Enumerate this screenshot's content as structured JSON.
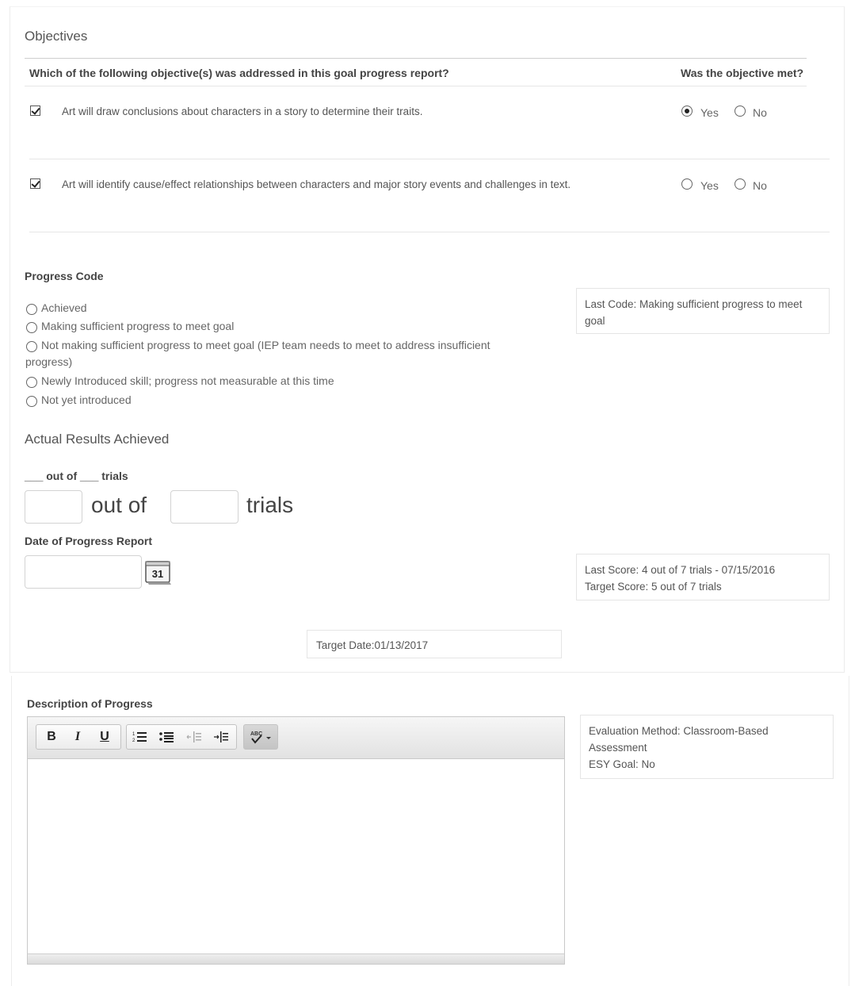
{
  "objectives": {
    "title": "Objectives",
    "question": "Which of the following objective(s) was addressed in this goal progress report?",
    "met_header": "Was the objective met?",
    "items": [
      {
        "text": "Art will draw conclusions about characters in a story to determine their traits.",
        "checked": true,
        "met": "Yes"
      },
      {
        "text": "Art will identify cause/effect relationships between characters and major story events and challenges in text.",
        "checked": true,
        "met": null
      }
    ],
    "yes_label": "Yes",
    "no_label": "No"
  },
  "progress_code": {
    "label": "Progress Code",
    "options": [
      "Achieved",
      "Making sufficient progress to meet goal",
      "Not making sufficient progress to meet goal (IEP team needs to meet to address insufficient",
      "progress)",
      "Newly Introduced skill; progress not measurable at this time",
      "Not yet introduced"
    ],
    "last_code": "Last Code: Making sufficient progress to meet goal"
  },
  "results": {
    "title": "Actual Results Achieved",
    "format_label": "___ out of ___ trials",
    "out_of": "out of",
    "trials": "trials",
    "date_label": "Date of Progress Report",
    "calendar_day": "31",
    "last_score": "Last Score: 4 out of 7 trials - 07/15/2016",
    "target_score": "Target Score: 5 out of 7 trials",
    "target_date": "Target Date:01/13/2017"
  },
  "description": {
    "label": "Description of Progress",
    "toolbar": {
      "bold": "B",
      "italic": "I",
      "underline": "U",
      "spell": "ABC"
    },
    "evaluation": "Evaluation Method: Classroom-Based Assessment",
    "esy": "ESY Goal: No"
  }
}
